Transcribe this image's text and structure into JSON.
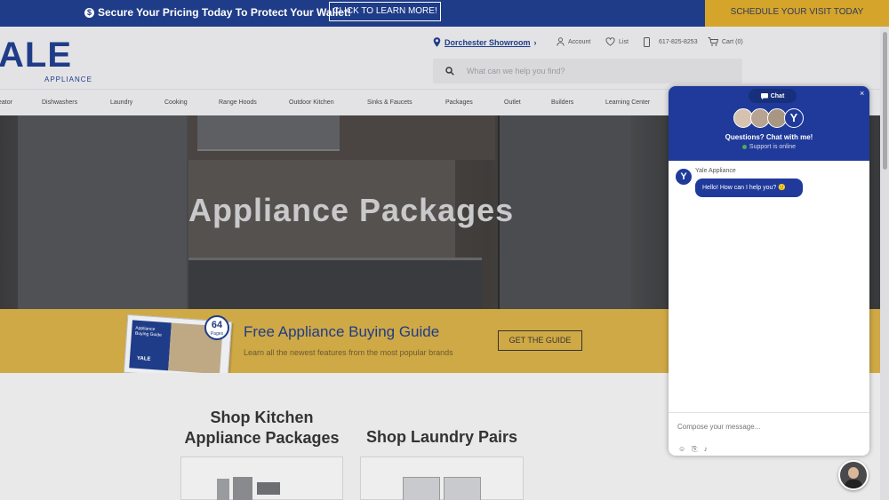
{
  "topbar": {
    "promo_text": "Secure Your Pricing Today To Protect Your Wallet!",
    "learn_more_label": "CLICK TO LEARN MORE!",
    "schedule_label": "SCHEDULE YOUR VISIT TODAY"
  },
  "header": {
    "logo_text": "ALE",
    "logo_sub": "APPLIANCE",
    "showroom_label": "Dorchester Showroom",
    "account_label": "Account",
    "list_label": "List",
    "phone_label": "617-825-8253",
    "cart_label": "Cart (0)",
    "search_placeholder": "What can we help you find?"
  },
  "nav": {
    "items": [
      "eator",
      "Dishwashers",
      "Laundry",
      "Cooking",
      "Range Hoods",
      "Outdoor Kitchen",
      "Sinks & Faucets",
      "Packages",
      "Outlet",
      "Builders",
      "Learning Center"
    ]
  },
  "hero": {
    "title": "Appliance Packages"
  },
  "guide": {
    "title": "Free Appliance Buying Guide",
    "subtitle": "Learn all the newest features from the most popular brands",
    "button_label": "GET THE GUIDE",
    "badge_number": "64",
    "badge_unit": "Pages",
    "book_title": "Appliance Buying Guide",
    "book_brand": "YALE"
  },
  "shop": {
    "kitchen_title_line1": "Shop Kitchen",
    "kitchen_title_line2": "Appliance Packages",
    "laundry_title": "Shop Laundry Pairs"
  },
  "chat": {
    "tab_label": "Chat",
    "close_symbol": "×",
    "headline": "Questions? Chat with me!",
    "status": "Support is online",
    "bot_name": "Yale Appliance",
    "bot_initial": "Y",
    "bot_message": "Hello! How can I help you? 🙂",
    "compose_placeholder": "Compose your message..."
  },
  "colors": {
    "brand_blue": "#1f3c88",
    "gold": "#d5a52b",
    "chat_blue": "#1f3a9a"
  }
}
